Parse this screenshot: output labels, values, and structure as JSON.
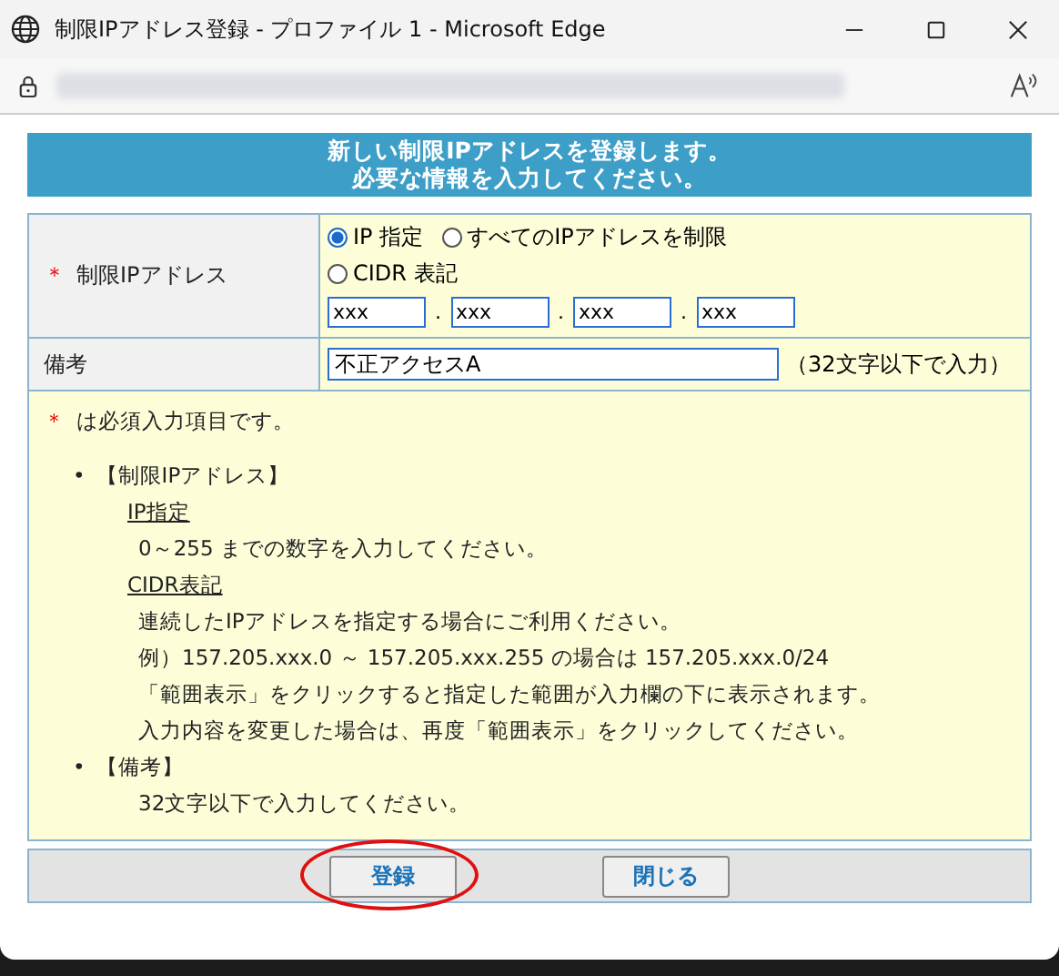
{
  "window": {
    "title": "制限IPアドレス登録 - プロファイル 1 - Microsoft Edge"
  },
  "banner": {
    "lines": [
      "新しい制限IPアドレスを登録します。",
      "必要な情報を入力してください。"
    ]
  },
  "form": {
    "ip_row": {
      "required_mark": "＊",
      "label": "制限IPアドレス",
      "options": [
        {
          "label": "IP 指定",
          "selected": true
        },
        {
          "label": "すべてのIPアドレスを制限",
          "selected": false
        },
        {
          "label": "CIDR 表記",
          "selected": false
        }
      ],
      "octets": [
        {
          "value": "xxx"
        },
        {
          "value": "xxx"
        },
        {
          "value": "xxx"
        },
        {
          "value": "xxx"
        }
      ],
      "separators": [
        ".",
        ".",
        "."
      ]
    },
    "note_row": {
      "label": "備考",
      "value": "不正アクセスA",
      "hint": "（32文字以下で入力）"
    }
  },
  "help": {
    "required_mark": "＊",
    "required_text": "は必須入力項目です。",
    "sections": [
      {
        "bullet": "•",
        "title": "【制限IPアドレス】",
        "groups": [
          {
            "heading": "IP指定",
            "lines": [
              "0～255 までの数字を入力してください。"
            ]
          },
          {
            "heading": "CIDR表記",
            "lines": [
              "連続したIPアドレスを指定する場合にご利用ください。",
              "例）157.205.xxx.0 ～ 157.205.xxx.255 の場合は 157.205.xxx.0/24",
              "「範囲表示」をクリックすると指定した範囲が入力欄の下に表示されます。",
              "入力内容を変更した場合は、再度「範囲表示」をクリックしてください。"
            ]
          }
        ]
      },
      {
        "bullet": "•",
        "title": "【備考】",
        "groups": [
          {
            "lines": [
              "32文字以下で入力してください。"
            ]
          }
        ]
      }
    ]
  },
  "buttons": [
    {
      "label": "登録",
      "highlighted": true
    },
    {
      "label": "閉じる",
      "highlighted": false
    }
  ]
}
